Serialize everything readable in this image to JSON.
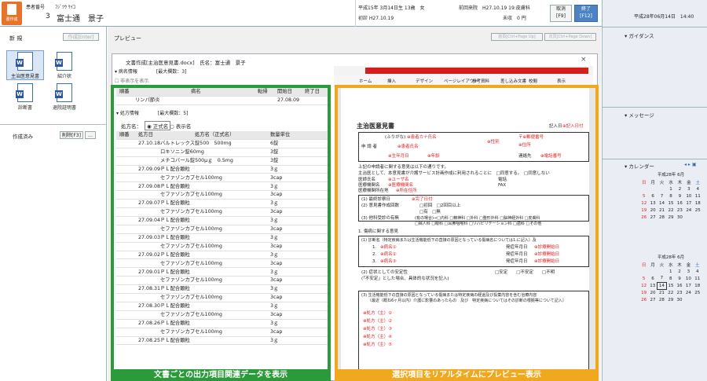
{
  "header": {
    "app_label": "書作成",
    "patient_no_label": "患者番号",
    "patient_kana": "ﾌｼﾞﾂｳ ｹｲｺ",
    "patient_id": "3",
    "patient_name": "富士通　景子",
    "birth": "平成15年 3月14日生 13歳　女",
    "first_visit": "初診 H27.10.19",
    "prev_visit": "前回来院　H27.10.19 19:皮膚科",
    "unpaid": "未収　0 円",
    "cancel_label": "取消",
    "cancel_key": "[F9]",
    "end_label": "終了",
    "end_key": "[F12]",
    "datetime": "平成28年06月14日　14:40"
  },
  "left": {
    "new_label": "新 規",
    "create_btn": "作成[Enter]",
    "docs": [
      {
        "label": "主治医意見書"
      },
      {
        "label": "紹介状"
      },
      {
        "label": "診断書"
      },
      {
        "label": "退院証明書"
      }
    ],
    "done_label": "作成済み",
    "delete_btn": "削除[F3]",
    "more_btn": "…"
  },
  "preview": {
    "label": "プレビュー",
    "prev_btn": "前頁[Ctrl+Page Up]",
    "next_btn": "次頁[Ctrl+Page Down]",
    "window_title": "文書作成[主治医意見書.docx]　氏名：富士通　景子",
    "close": "×"
  },
  "left_table": {
    "disease_section": "▾ 病名情報　　　　[最大欄数：3]",
    "show_ended": "非表示を表示",
    "disease_headers": [
      "順番",
      "病名",
      "転帰",
      "開始日",
      "終了日"
    ],
    "disease_rows": [
      {
        "name": "リンパ節炎",
        "start": "27.08.09"
      }
    ],
    "rx_section": "▾ 処方情報　　　　[最大欄数：5]",
    "rx_name_label": "処方名：",
    "rx_opt1": "正式名",
    "rx_opt2": "表示名",
    "rx_headers": [
      "順番",
      "処方日",
      "処方名（正式名）",
      "数量単位"
    ],
    "rx_rows": [
      {
        "date": "27.10.18",
        "name": "バルトレックス錠500　500mg",
        "qty": "6錠"
      },
      {
        "date": "",
        "name": "ロキソニン錠60mg",
        "qty": "3錠"
      },
      {
        "date": "",
        "name": "メチコバール錠500μｇ　0.5mg",
        "qty": "3錠"
      },
      {
        "date": "27.09.09",
        "name": "ＰＬ配合顆粒",
        "qty": "3ｇ"
      },
      {
        "date": "",
        "name": "セファゾンカプセル100mg",
        "qty": "3cap"
      },
      {
        "date": "27.09.08",
        "name": "ＰＬ配合顆粒",
        "qty": "3ｇ"
      },
      {
        "date": "",
        "name": "セファゾンカプセル100mg",
        "qty": "3cap"
      },
      {
        "date": "27.09.07",
        "name": "ＰＬ配合顆粒",
        "qty": "3ｇ"
      },
      {
        "date": "",
        "name": "セファゾンカプセル100mg",
        "qty": "3cap"
      },
      {
        "date": "27.09.04",
        "name": "ＰＬ配合顆粒",
        "qty": "3ｇ"
      },
      {
        "date": "",
        "name": "セファゾンカプセル100mg",
        "qty": "3cap"
      },
      {
        "date": "27.09.03",
        "name": "ＰＬ配合顆粒",
        "qty": "3ｇ"
      },
      {
        "date": "",
        "name": "セファゾンカプセル100mg",
        "qty": "3cap"
      },
      {
        "date": "27.09.02",
        "name": "ＰＬ配合顆粒",
        "qty": "3ｇ"
      },
      {
        "date": "",
        "name": "セファゾンカプセル100mg",
        "qty": "3cap"
      },
      {
        "date": "27.09.01",
        "name": "ＰＬ配合顆粒",
        "qty": "3ｇ"
      },
      {
        "date": "",
        "name": "セファゾンカプセル100mg",
        "qty": "3cap"
      },
      {
        "date": "27.08.31",
        "name": "ＰＬ配合顆粒",
        "qty": "3ｇ"
      },
      {
        "date": "",
        "name": "セファゾンカプセル100mg",
        "qty": "3cap"
      },
      {
        "date": "27.08.30",
        "name": "ＰＬ配合顆粒",
        "qty": "3ｇ"
      },
      {
        "date": "",
        "name": "セファゾンカプセル100mg",
        "qty": "3cap"
      },
      {
        "date": "27.08.26",
        "name": "ＰＬ配合顆粒",
        "qty": "3ｇ"
      },
      {
        "date": "",
        "name": "セファゾンカプセル100mg",
        "qty": "3cap"
      },
      {
        "date": "27.08.25",
        "name": "ＰＬ配合顆粒",
        "qty": "3ｇ"
      }
    ]
  },
  "word": {
    "tabs": [
      "ホーム",
      "挿入",
      "デザイン",
      "ページレイアウト",
      "参考資料",
      "差し込み文書",
      "校閲",
      "表示"
    ],
    "doc_title": "主治医意見書",
    "entry_date_label": "記入日",
    "entry_date": "⊕記入日付",
    "kana_label": "(ふりがな)",
    "kana_val": "⊕患者カナ氏名",
    "name_label": "申 請 者",
    "name_val": "⊕患者氏名",
    "birth_val": "⊕生年月日",
    "age_val": "⊕年齢",
    "sex_val": "⊕性別",
    "zip": "〒⊕郵便番号",
    "addr": "⊕住所",
    "tel": "連絡先",
    "tel_val": "⊕電話番号",
    "consent": "上記の申請者に関する意見は以下の通りです。",
    "consent2": "主治医として、本意見書が介護サービス計画作成に利用されることに　□同意する。　□同意しない",
    "doctor": "医師氏名",
    "doctor_val": "⊕ユーザ名",
    "inst": "医療機関名",
    "inst_val": "⊕医療機関名",
    "inst_addr": "医療機関所在地",
    "inst_addr_val": "⊕所在住所",
    "phone": "電話",
    "fax": "FAX",
    "q1": "(1) 最終診察日",
    "q1v": "⊕完了日付",
    "q2": "(2) 意見書作成回数",
    "q2v": "□初回　□2回目以上",
    "q3": "(3) 他科受診の有無",
    "q3v": "□有　□無",
    "q3d": "(有の場合)→□内科 □精神科 □外科 □整形外科 □脳神経外科 □皮膚科",
    "q3e": "□婦人科 □眼科 □耳鼻咽喉科 □リハビリテーション科 □歯科 □その他",
    "s1": "1. 傷病に関する意見",
    "s1d": "(1) 診断名（特定疾病または生活機能低下の直接の原因となっている傷病名については1.に記入）及",
    "d1": "1.",
    "d1v": "⊕病名①",
    "d2": "2.",
    "d2v": "⊕病名②",
    "d3": "3.",
    "d3v": "⊕病名③",
    "onset": "発症年月日",
    "onset_v": "⊕診療開始日",
    "q4": "(2) 症状としての安定性",
    "q4v": "□安定　　□不安定　　□不明",
    "q4d": "(「不安定」とした場合、具体的な状況を記入)",
    "q5": "(3) 生活機能低下の直接の原因となっている傷病または特定疾病の経過及び投薬内容を含む治療内容",
    "q5d": "〔最近（概ね6ヶ月以内）介護に影響のあったもの　及び　特定疾病についてはその診断の根拠等について記入〕",
    "rx_lines": [
      "⊕処方（主）①",
      "⊕処方（主）②",
      "⊕処方（主）③",
      "⊕処方（主）④",
      "⊕処方（主）⑤"
    ]
  },
  "captions": {
    "green": "文書ごとの出力項目関連データを表示",
    "orange": "選択項目をリアルタイムにプレビュー表示"
  },
  "right": {
    "guidance": "▾ ガイダンス",
    "message": "▾ メッセージ",
    "calendar": "▾ カレンダー",
    "cal1_title": "平成28年 6月",
    "cal2_title": "平成28年 6月",
    "dow": [
      "日",
      "月",
      "火",
      "水",
      "木",
      "金",
      "土"
    ]
  },
  "colors": {
    "green": "#2a9a3a",
    "orange": "#f0a81e",
    "accent": "#4d83c4"
  }
}
